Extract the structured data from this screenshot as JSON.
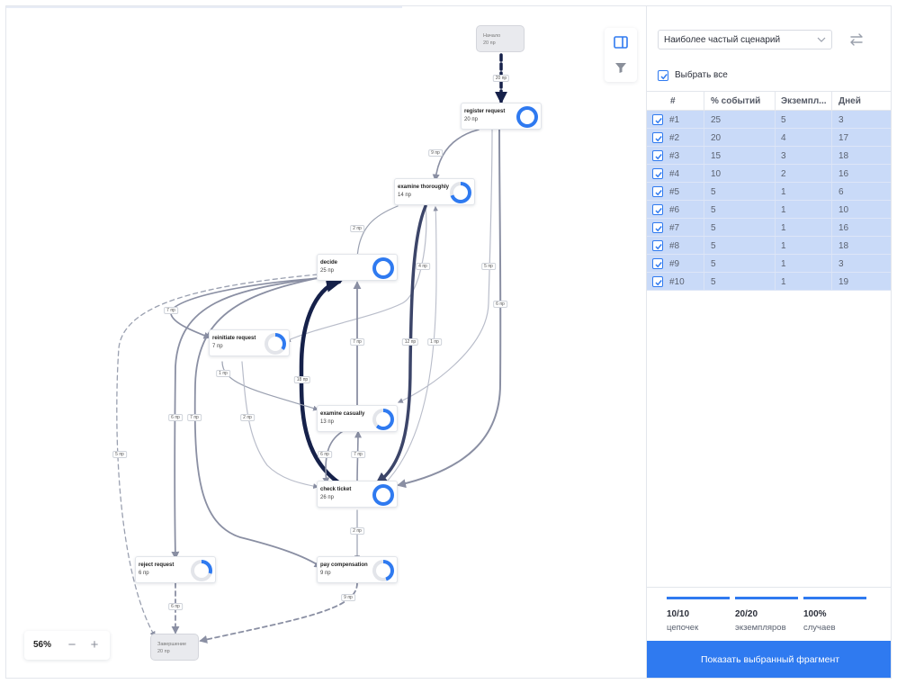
{
  "graph": {
    "nodes": [
      {
        "id": "start",
        "kind": "term",
        "name": "Начало",
        "count": "20 пр"
      },
      {
        "id": "register",
        "kind": "node",
        "name": "register request",
        "count": "20 пр",
        "fill": 1.0
      },
      {
        "id": "examine_thoroughly",
        "kind": "node",
        "name": "examine thoroughly",
        "count": "14 пр",
        "fill": 0.7
      },
      {
        "id": "decide",
        "kind": "node",
        "name": "decide",
        "count": "25 пр",
        "fill": 1.0
      },
      {
        "id": "reinitiate",
        "kind": "node",
        "name": "reinitiate request",
        "count": "7 пр",
        "fill": 0.35
      },
      {
        "id": "examine_casually",
        "kind": "node",
        "name": "examine casually",
        "count": "13 пр",
        "fill": 0.62
      },
      {
        "id": "check_ticket",
        "kind": "node",
        "name": "check ticket",
        "count": "26 пр",
        "fill": 1.0
      },
      {
        "id": "reject",
        "kind": "node",
        "name": "reject request",
        "count": "6 пр",
        "fill": 0.3
      },
      {
        "id": "pay",
        "kind": "node",
        "name": "pay compensation",
        "count": "9 пр",
        "fill": 0.45
      },
      {
        "id": "end",
        "kind": "term",
        "name": "Завершение",
        "count": "20 пр"
      }
    ],
    "edges": [
      {
        "id": "e-start-register",
        "label": "20 пр"
      },
      {
        "id": "e-register-et",
        "label": "9 пр"
      },
      {
        "id": "e-register-ec",
        "label": "5 пр"
      },
      {
        "id": "e-register-ct",
        "label": "6 пр"
      },
      {
        "id": "e-et-decide",
        "label": "2 пр"
      },
      {
        "id": "e-et-reinit",
        "label": "4 пр"
      },
      {
        "id": "e-et-ct",
        "label": "12 пр"
      },
      {
        "id": "e-ct-et",
        "label": "1 пр"
      },
      {
        "id": "e-decide-reinit",
        "label": "7 пр"
      },
      {
        "id": "e-ec-decide",
        "label": "7 пр"
      },
      {
        "id": "e-ct-decide",
        "label": "18 пр"
      },
      {
        "id": "e-decide-end",
        "label": "5 пр"
      },
      {
        "id": "e-decide-reject",
        "label": "6 пр"
      },
      {
        "id": "e-decide-pay",
        "label": "7 пр"
      },
      {
        "id": "e-reinit-ec",
        "label": "1 пр"
      },
      {
        "id": "e-reinit-ct",
        "label": "2 пр"
      },
      {
        "id": "e-ec-ct",
        "label": "6 пр"
      },
      {
        "id": "e-ct-ec",
        "label": "7 пр"
      },
      {
        "id": "e-ct-pay",
        "label": "2 пр"
      },
      {
        "id": "e-reject-end",
        "label": "6 пр"
      },
      {
        "id": "e-pay-end",
        "label": "9 пр"
      }
    ]
  },
  "zoom": {
    "value": "56%",
    "minus": "−",
    "plus": "+"
  },
  "panel": {
    "scenario": "Наиболее частый сценарий",
    "select_all": "Выбрать все",
    "columns": [
      "#",
      "% событий",
      "Экземпл...",
      "Дней"
    ],
    "rows": [
      {
        "id": "#1",
        "pct": "25",
        "inst": "5",
        "days": "3"
      },
      {
        "id": "#2",
        "pct": "20",
        "inst": "4",
        "days": "17"
      },
      {
        "id": "#3",
        "pct": "15",
        "inst": "3",
        "days": "18"
      },
      {
        "id": "#4",
        "pct": "10",
        "inst": "2",
        "days": "16"
      },
      {
        "id": "#5",
        "pct": "5",
        "inst": "1",
        "days": "6"
      },
      {
        "id": "#6",
        "pct": "5",
        "inst": "1",
        "days": "10"
      },
      {
        "id": "#7",
        "pct": "5",
        "inst": "1",
        "days": "16"
      },
      {
        "id": "#8",
        "pct": "5",
        "inst": "1",
        "days": "18"
      },
      {
        "id": "#9",
        "pct": "5",
        "inst": "1",
        "days": "3"
      },
      {
        "id": "#10",
        "pct": "5",
        "inst": "1",
        "days": "19"
      }
    ],
    "stats": [
      {
        "value": "10/10",
        "label": "цепочек"
      },
      {
        "value": "20/20",
        "label": "экземпляров"
      },
      {
        "value": "100%",
        "label": "случаев"
      }
    ],
    "show_button": "Показать выбранный фрагмент"
  },
  "colors": {
    "accent": "#2f7af0",
    "row_selected": "#c9daf8",
    "edge": "#8a8fa3",
    "edge_dark": "#16214a",
    "donut_track": "#e3e5ea"
  }
}
